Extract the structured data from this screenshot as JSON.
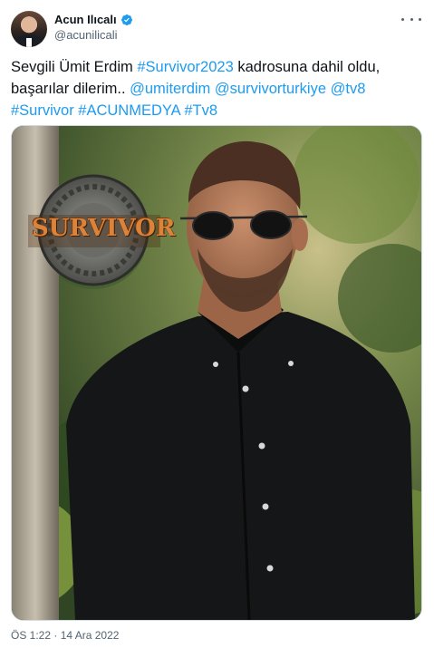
{
  "author": {
    "display_name": "Acun Ilıcalı",
    "handle": "@acunilicali",
    "verified": true
  },
  "tweet": {
    "text_parts": [
      {
        "type": "text",
        "value": "Sevgili Ümit Erdim "
      },
      {
        "type": "link",
        "value": "#Survivor2023"
      },
      {
        "type": "text",
        "value": " kadrosuna dahil oldu, başarılar dilerim.. "
      },
      {
        "type": "link",
        "value": "@umiterdim"
      },
      {
        "type": "text",
        "value": " "
      },
      {
        "type": "link",
        "value": "@survivorturkiye"
      },
      {
        "type": "text",
        "value": " "
      },
      {
        "type": "link",
        "value": "@tv8"
      },
      {
        "type": "text",
        "value": " "
      },
      {
        "type": "link",
        "value": "#Survivor"
      },
      {
        "type": "text",
        "value": " "
      },
      {
        "type": "link",
        "value": "#ACUNMEDYA"
      },
      {
        "type": "text",
        "value": " "
      },
      {
        "type": "link",
        "value": "#Tv8"
      }
    ]
  },
  "media": {
    "logo_text": "SURVIVOR"
  },
  "timestamp": "ÖS 1:22 · 14 Ara 2022",
  "colors": {
    "link": "#1d9bf0",
    "text": "#0f1419",
    "secondary": "#536471",
    "verified": "#1d9bf0"
  }
}
